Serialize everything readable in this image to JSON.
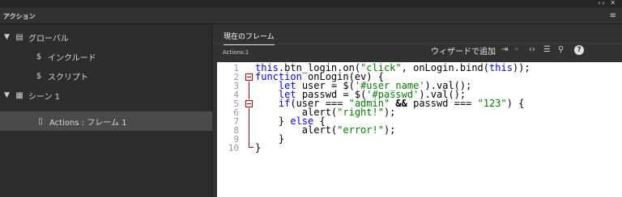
{
  "window": {
    "controls": "‹‹ ✕",
    "menu_icon": "hamburger-icon"
  },
  "panel": {
    "title": "アクション"
  },
  "sidebar": {
    "items": [
      {
        "label": "グローバル",
        "icon": "document-icon",
        "expanded": true
      },
      {
        "label": "インクルード",
        "icon": "include-script-icon"
      },
      {
        "label": "スクリプト",
        "icon": "script-icon"
      },
      {
        "label": "シーン 1",
        "icon": "scene-icon",
        "expanded": true
      },
      {
        "label": "Actions : フレーム 1",
        "icon": "frame-icon",
        "selected": true
      }
    ]
  },
  "main": {
    "tab": "現在のフレーム",
    "subtitle": "Actions:1",
    "toolbar": {
      "wizard_label": "ウィザードで追加",
      "icons": [
        "pin-icon",
        "target-icon",
        "code-brackets-icon",
        "format-icon",
        "search-icon",
        "help-icon"
      ],
      "help_label": "?"
    }
  },
  "editor": {
    "line_numbers": [
      "1",
      "2",
      "3",
      "4",
      "5",
      "6",
      "7",
      "8",
      "9",
      "10"
    ],
    "lines": [
      [
        [
          "kw",
          "this"
        ],
        [
          "t",
          ".btn_login.on("
        ],
        [
          "str",
          "\"click\""
        ],
        [
          "t",
          ", onLogin.bind("
        ],
        [
          "kw",
          "this"
        ],
        [
          "t",
          "));"
        ]
      ],
      [
        [
          "kw",
          "function"
        ],
        [
          "t",
          " onLogin(ev) {"
        ]
      ],
      [
        [
          "t",
          "    "
        ],
        [
          "kw",
          "let"
        ],
        [
          "t",
          " user = $("
        ],
        [
          "str",
          "'#user_name'"
        ],
        [
          "t",
          ").val();"
        ]
      ],
      [
        [
          "t",
          "    "
        ],
        [
          "kw",
          "let"
        ],
        [
          "t",
          " passwd = $("
        ],
        [
          "str",
          "'#passwd'"
        ],
        [
          "t",
          ").val();"
        ]
      ],
      [
        [
          "t",
          "    "
        ],
        [
          "kw",
          "if"
        ],
        [
          "t",
          "(user === "
        ],
        [
          "str",
          "\"admin\""
        ],
        [
          "t",
          " "
        ],
        [
          "op",
          "&&"
        ],
        [
          "t",
          " passwd === "
        ],
        [
          "str",
          "\"123\""
        ],
        [
          "t",
          ") {"
        ]
      ],
      [
        [
          "t",
          "        alert("
        ],
        [
          "str",
          "\"right!\""
        ],
        [
          "t",
          ");"
        ]
      ],
      [
        [
          "t",
          "    } "
        ],
        [
          "kw",
          "else"
        ],
        [
          "t",
          " {"
        ]
      ],
      [
        [
          "t",
          "        alert("
        ],
        [
          "str",
          "\"error!\""
        ],
        [
          "t",
          ");"
        ]
      ],
      [
        [
          "t",
          "    }"
        ]
      ],
      [
        [
          "t",
          "}"
        ]
      ]
    ]
  }
}
